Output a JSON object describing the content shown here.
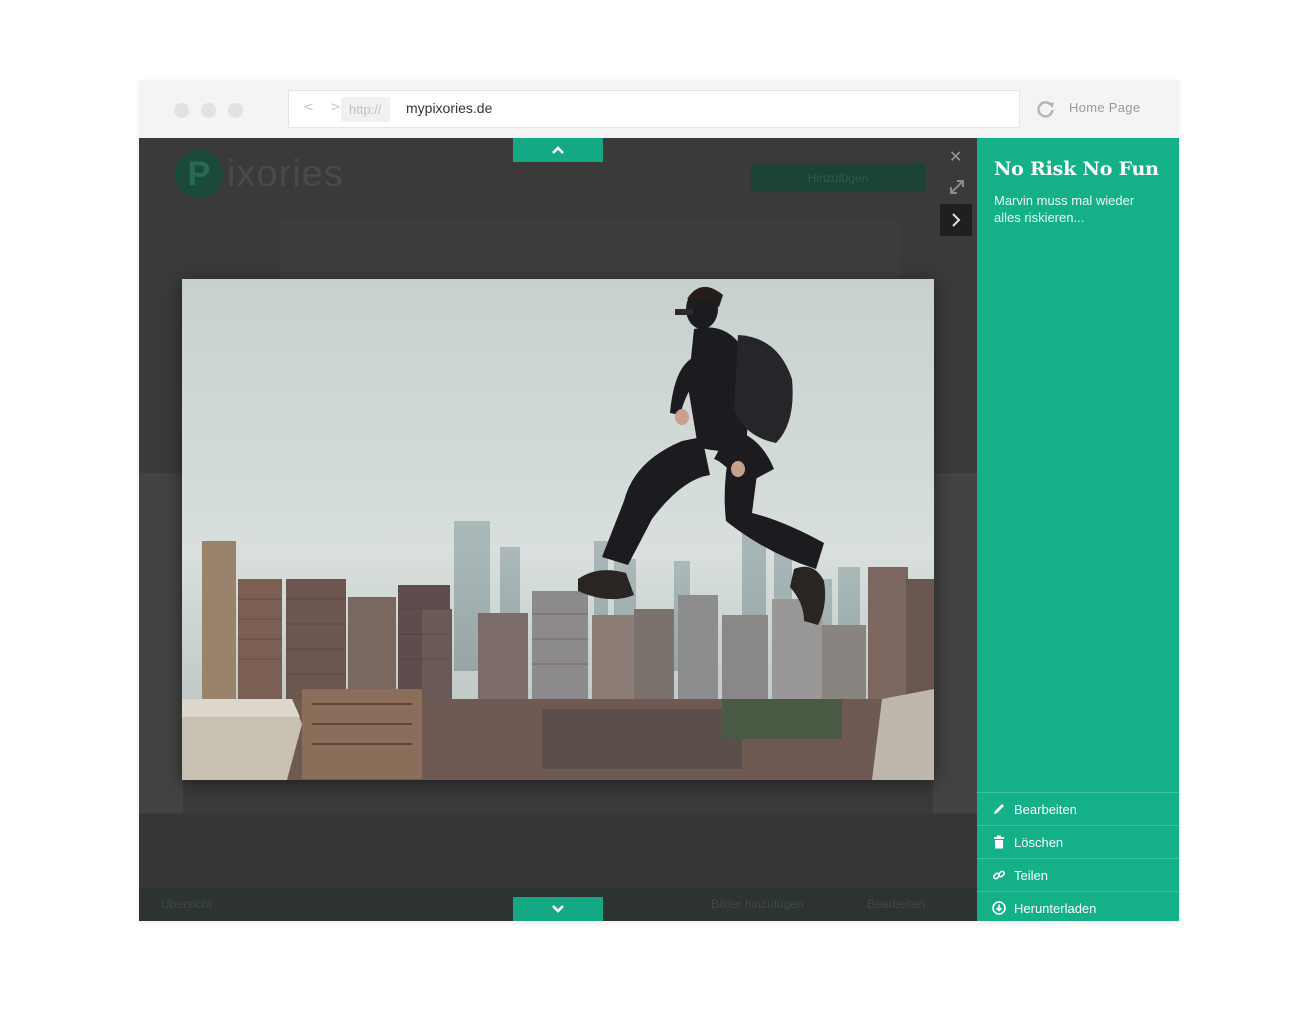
{
  "browser": {
    "protocol": "http://",
    "domain": "mypixories.de",
    "nav_arrows": "< >",
    "home_link": "Home Page"
  },
  "background_page": {
    "logo_badge": "P",
    "logo_text": "ixories",
    "add_button": "Hinzufügen",
    "bottom_left": "Übersicht",
    "bottom_mid": "Bilder hinzufügen",
    "bottom_right": "Bearbeiten"
  },
  "lightbox": {
    "icons": {
      "up": "chevron-up-icon",
      "down": "chevron-down-icon",
      "close": "close-icon",
      "expand": "expand-icon",
      "next": "chevron-right-icon"
    },
    "photo_alt": "Mann springt über Hochhausdächer vor einer Stadtkulisse"
  },
  "sidebar": {
    "title": "No Risk No Fun",
    "description": "Marvin muss mal wieder alles riskieren...",
    "actions": [
      {
        "label": "Bearbeiten",
        "icon": "pencil-icon"
      },
      {
        "label": "Löschen",
        "icon": "trash-icon"
      },
      {
        "label": "Teilen",
        "icon": "link-icon"
      },
      {
        "label": "Herunterladen",
        "icon": "download-icon"
      }
    ]
  },
  "colors": {
    "accent": "#14b088",
    "accent_tab": "#14a885",
    "overlay": "#3a3a3a"
  }
}
